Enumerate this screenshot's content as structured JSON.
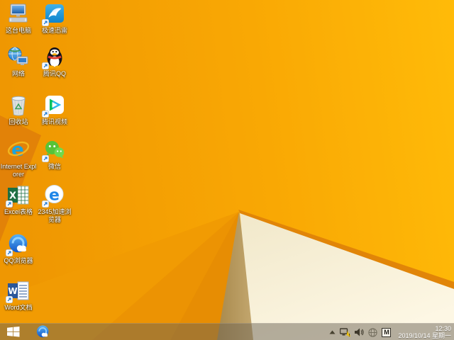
{
  "wallpaper": {
    "main_color": "#f7a304",
    "highlight_color": "#ffbb08",
    "dark_fold_color": "#e28208",
    "shadow_facet_color": "#b3945a",
    "paper_facet_color": "#f6eed4",
    "ridge_color": "#e18508"
  },
  "desktop": {
    "icons": [
      {
        "id": "this-pc",
        "label": "这台电脑",
        "shortcut": false
      },
      {
        "id": "network",
        "label": "网络",
        "shortcut": false
      },
      {
        "id": "recycle-bin",
        "label": "回收站",
        "shortcut": false
      },
      {
        "id": "internet-explorer",
        "label": "Internet Explorer",
        "shortcut": false
      },
      {
        "id": "excel",
        "label": "Excel表格",
        "shortcut": true
      },
      {
        "id": "qq-browser",
        "label": "QQ浏览器",
        "shortcut": true
      },
      {
        "id": "word",
        "label": "Word文档",
        "shortcut": true
      },
      {
        "id": "xunlei",
        "label": "极速迅雷",
        "shortcut": true
      },
      {
        "id": "tencent-qq",
        "label": "腾讯QQ",
        "shortcut": true
      },
      {
        "id": "tencent-video",
        "label": "腾讯视频",
        "shortcut": true
      },
      {
        "id": "wechat",
        "label": "微信",
        "shortcut": true
      },
      {
        "id": "2345-browser",
        "label": "2345加速浏览器",
        "shortcut": true
      }
    ]
  },
  "taskbar": {
    "pinned": [
      {
        "id": "qq-browser-taskbar",
        "name": "qq-browser-icon"
      }
    ],
    "tray": {
      "icons": [
        "chevron-up-icon",
        "network-warning-icon",
        "volume-icon",
        "globe-icon",
        "ime-indicator"
      ],
      "ime_label": "M"
    },
    "clock": {
      "time": "12:30",
      "date": "2019/10/14 星期一"
    }
  }
}
